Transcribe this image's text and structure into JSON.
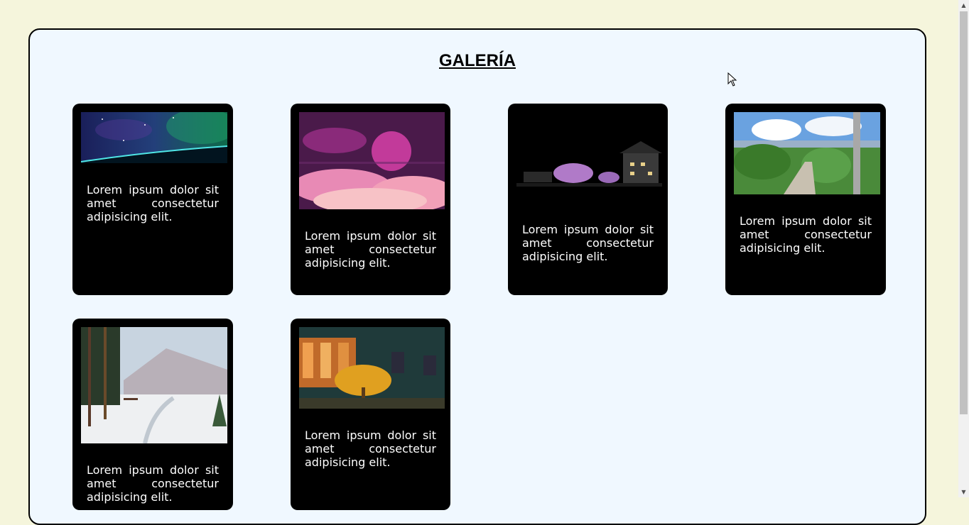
{
  "page": {
    "title": "GALERÍA"
  },
  "cards": [
    {
      "caption": "Lorem ipsum dolor sit amet consectetur adipisicing elit.",
      "image": "galaxy-horizon"
    },
    {
      "caption": "Lorem ipsum dolor sit amet consectetur adipisicing elit.",
      "image": "pink-clouds-moon"
    },
    {
      "caption": "Lorem ipsum dolor sit amet consectetur adipisicing elit.",
      "image": "night-castle-blossoms"
    },
    {
      "caption": "Lorem ipsum dolor sit amet consectetur adipisicing elit.",
      "image": "green-town-path"
    },
    {
      "caption": "Lorem ipsum dolor sit amet consectetur adipisicing elit.",
      "image": "snowy-forest-landscape"
    },
    {
      "caption": "Lorem ipsum dolor sit amet consectetur adipisicing elit.",
      "image": "autumn-tree-courtyard"
    }
  ],
  "colors": {
    "page_background": "#f5f5dc",
    "panel_background": "#f0f8ff",
    "card_background": "#000000",
    "caption_text": "#ffffff"
  },
  "icons": {
    "scroll_up": "arrow-up-icon",
    "scroll_down": "arrow-down-icon",
    "cursor": "mouse-pointer-icon"
  }
}
